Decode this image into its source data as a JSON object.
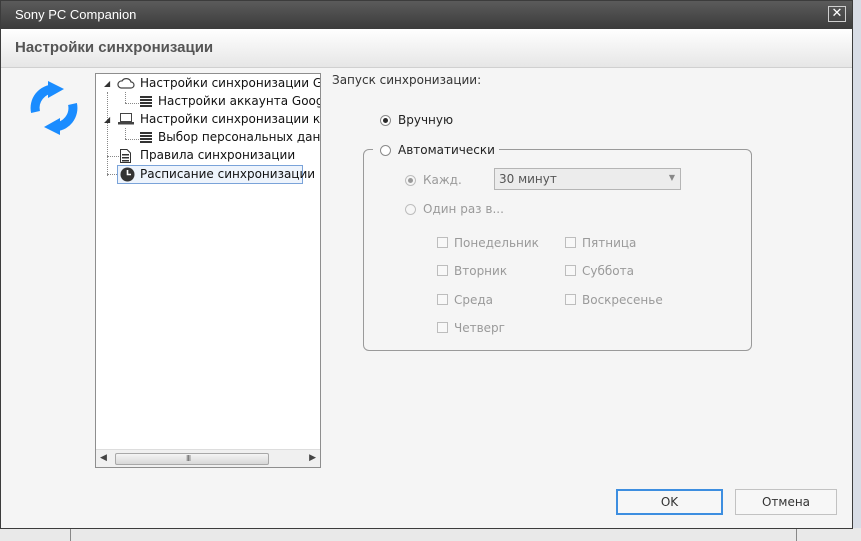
{
  "window": {
    "title": "Sony PC Companion",
    "close_glyph": "✕",
    "header_title": "Настройки синхронизации"
  },
  "tree": {
    "items": [
      {
        "label": "Настройки синхронизации Goog",
        "icon": "cloud-icon",
        "expander": "◢"
      },
      {
        "label": "Настройки аккаунта Google™",
        "icon": "list-icon"
      },
      {
        "label": "Настройки синхронизации комп",
        "icon": "laptop-icon",
        "expander": "◢"
      },
      {
        "label": "Выбор персональных данных",
        "icon": "list-icon"
      },
      {
        "label": "Правила синхронизации",
        "icon": "document-icon"
      },
      {
        "label": "Расписание синхронизации",
        "icon": "clock-icon",
        "selected": true
      }
    ],
    "scroll_left": "◀",
    "scroll_right": "▶",
    "scroll_grip": "III"
  },
  "schedule": {
    "start_label": "Запуск синхронизации:",
    "manual_label": "Вручную",
    "auto_label": "Автоматически",
    "every_label": "Кажд.",
    "interval_value": "30 минут",
    "once_label": "Один раз в...",
    "days": {
      "mon": "Понедельник",
      "tue": "Вторник",
      "wed": "Среда",
      "thu": "Четверг",
      "fri": "Пятница",
      "sat": "Суббота",
      "sun": "Воскресенье"
    }
  },
  "buttons": {
    "ok": "OK",
    "cancel": "Отмена"
  },
  "colors": {
    "accent": "#1a8cff",
    "default_button_border": "#3d8ee0"
  }
}
